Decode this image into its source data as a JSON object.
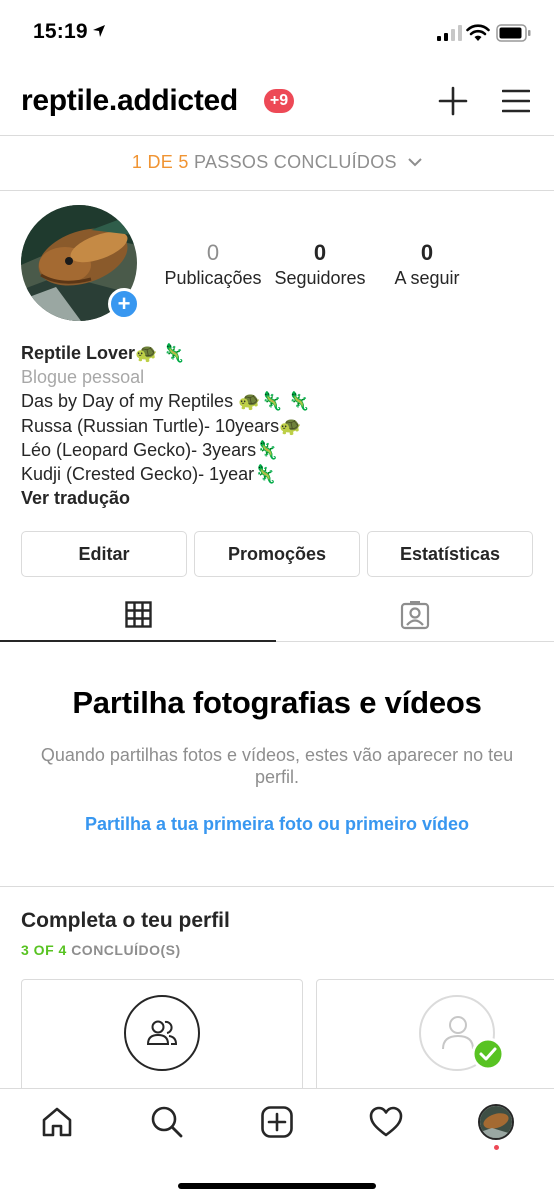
{
  "status_bar": {
    "time": "15:19"
  },
  "header": {
    "username": "reptile.addicted",
    "notification_badge": "+9"
  },
  "steps_banner": {
    "progress": "1 DE 5",
    "text": "PASSOS CONCLUÍDOS"
  },
  "profile": {
    "stats": [
      {
        "value": "0",
        "label": "Publicações"
      },
      {
        "value": "0",
        "label": "Seguidores"
      },
      {
        "value": "0",
        "label": "A seguir"
      }
    ],
    "bio": {
      "name": "Reptile Lover🐢 🦎",
      "category": "Blogue pessoal",
      "lines": [
        "Das by Day of my Reptiles 🐢🦎 🦎",
        "Russa (Russian Turtle)- 10years🐢",
        "Léo (Leopard Gecko)- 3years🦎",
        "Kudji (Crested Gecko)- 1year🦎"
      ],
      "translate": "Ver tradução"
    },
    "buttons": {
      "edit": "Editar",
      "promotions": "Promoções",
      "insights": "Estatísticas"
    }
  },
  "tabs": [
    {
      "name": "grid",
      "icon": "grid-icon"
    },
    {
      "name": "tagged",
      "icon": "tagged-user-icon"
    }
  ],
  "empty_state": {
    "title": "Partilha fotografias e vídeos",
    "description": "Quando partilhas fotos e vídeos, estes vão aparecer no teu perfil.",
    "link": "Partilha a tua primeira foto ou primeiro vídeo"
  },
  "complete_profile": {
    "title": "Completa o teu perfil",
    "progress": "3 OF 4",
    "progress_label": "CONCLUÍDO(S)",
    "cards": [
      {
        "icon": "people-icon",
        "done": false
      },
      {
        "icon": "profile-photo-icon",
        "done": true
      }
    ]
  },
  "colors": {
    "accent_blue": "#3897f0",
    "badge_red": "#ed4956",
    "orange": "#f09433",
    "green": "#58c322"
  },
  "bottom_nav": [
    "home-icon",
    "search-icon",
    "new-post-icon",
    "activity-heart-icon",
    "profile-avatar"
  ]
}
